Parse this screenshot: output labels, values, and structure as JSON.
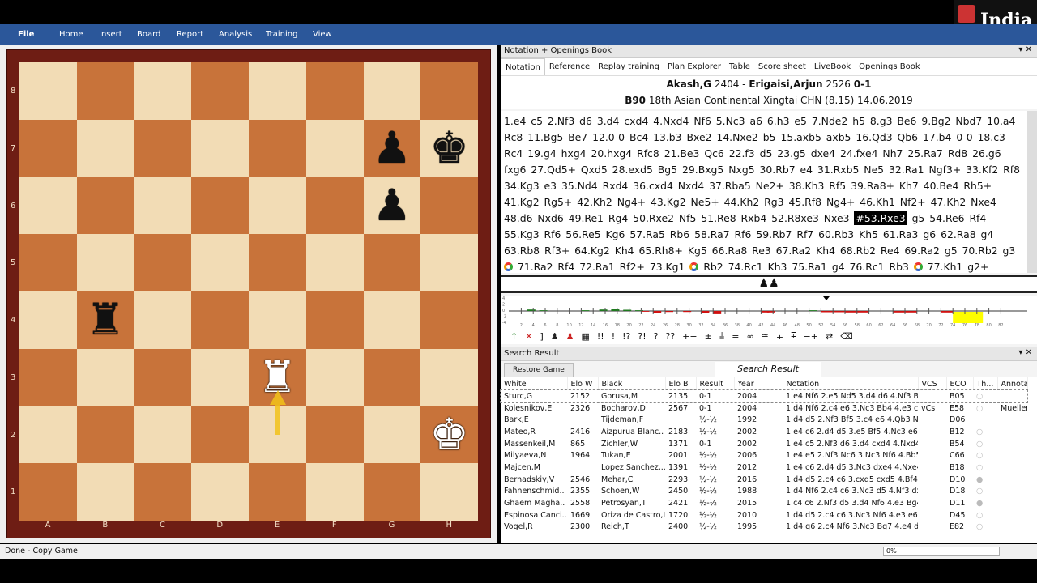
{
  "logo": "India",
  "menu": [
    "File",
    "Home",
    "Insert",
    "Board",
    "Report",
    "Analysis",
    "Training",
    "View"
  ],
  "board": {
    "ranks": [
      "8",
      "7",
      "6",
      "5",
      "4",
      "3",
      "2",
      "1"
    ],
    "files": [
      "A",
      "B",
      "C",
      "D",
      "E",
      "F",
      "G",
      "H"
    ],
    "pieces": {
      "g7": "black-pawn",
      "h7": "black-king",
      "g6": "black-pawn",
      "b4": "black-rook",
      "e3": "white-rook",
      "h2": "white-king"
    },
    "last_move_arrow": {
      "from": "e2",
      "to": "e3",
      "color": "#f2c21a"
    }
  },
  "panel_title": "Notation + Openings Book",
  "tabs": [
    "Notation",
    "Reference",
    "Replay training",
    "Plan Explorer",
    "Table",
    "Score sheet",
    "LiveBook",
    "Openings Book"
  ],
  "game": {
    "white": "Akash,G",
    "white_elo": "2404",
    "black": "Erigaisi,Arjun",
    "black_elo": "2526",
    "result": "0-1",
    "eco": "B90",
    "event": "18th Asian Continental Xingtai CHN (8.15) 14.06.2019"
  },
  "notation": [
    "1.e4 c5 2.Nf3 d6 3.d4 cxd4 4.Nxd4 Nf6 5.Nc3 a6 6.h3 e5 7.Nde2 h5 8.g3 Be6 9.Bg2 Nbd7 10.a4 Rc8 11.Bg5 Be7 12.0-0 Bc4 13.b3 Bxe2 14.Nxe2 b5 15.axb5 axb5 16.Qd3 Qb6 17.b4 0-0 18.c3 Rc4 19.g4 hxg4 20.hxg4 Rfc8 21.Be3 Qc6 22.f3 d5 23.g5 dxe4 24.fxe4 Nh7 25.Ra7 Rd8 26.g6 fxg6 27.Qd5+ Qxd5 28.exd5 Bg5 29.Bxg5 Nxg5 30.Rb7 e4 31.Rxb5 Ne5 32.Ra1 Ngf3+ 33.Kf2 Rf8 34.Kg3 e3 35.Nd4 Rxd4 36.cxd4 Nxd4 37.Rba5 Ne2+ 38.Kh3 Rf5 39.Ra8+ Kh7 40.Be4 Rh5+ 41.Kg2 Rg5+ 42.Kh2 Ng4+ 43.Kg2 Ne5+ 44.Kh2 Rg3 45.Rf8 Ng4+ 46.Kh1 Nf2+ 47.Kh2 Nxe4 48.d6 Nxd6 49.Re1 Rg4 50.Rxe2 Nf5 51.Re8 Rxb4 52.R8xe3 Nxe3",
    "#53.Rxe3",
    "g5 54.Re6 Rf4 55.Kg3 Rf6 56.Re5 Kg6 57.Ra5 Rb6 58.Ra7 Rf6 59.Rb7 Rf7 60.Rb3 Kh5 61.Ra3 g6 62.Ra8 g4 63.Rb8 Rf3+ 64.Kg2 Kh4 65.Rh8+ Kg5 66.Ra8 Re3 67.Ra2 Kh4 68.Rb2 Re4 69.Ra2 g5 70.Rb2 g3",
    "@",
    "71.Ra2 Rf4 72.Ra1 Rf2+ 73.Kg1",
    "@",
    "Rb2 74.Rc1 Kh3 75.Ra1 g4 76.Rc1 Rb3",
    "@",
    "77.Kh1 g2+ 78.Kg1 Rf3",
    "@"
  ],
  "graph": {
    "y_ticks": [
      "4",
      "2",
      "0",
      "-2",
      "-4"
    ],
    "x_ticks": [
      "2",
      "4",
      "6",
      "8",
      "10",
      "12",
      "14",
      "16",
      "18",
      "20",
      "22",
      "24",
      "26",
      "28",
      "30",
      "32",
      "34",
      "36",
      "38",
      "40",
      "42",
      "44",
      "46",
      "48",
      "50",
      "52",
      "54",
      "56",
      "58",
      "60",
      "62",
      "64",
      "66",
      "68",
      "70",
      "72",
      "74",
      "76",
      "78",
      "80",
      "82"
    ],
    "white_color": "#1e7a1e",
    "black_color": "#d01010",
    "highlight_color": "#ffff00"
  },
  "symbols": [
    "↑",
    "✕",
    "]",
    "♟",
    "♟",
    "▦",
    "!!",
    "!",
    "!?",
    "?!",
    "?",
    "??",
    "+−",
    "±",
    "⩲",
    "=",
    "∞",
    "≅",
    "∓",
    "⩱",
    "−+",
    "⇄",
    "⌫"
  ],
  "search": {
    "title": "Search Result",
    "restore": "Restore Game",
    "columns": [
      "White",
      "Elo W",
      "Black",
      "Elo B",
      "Result",
      "Year",
      "Notation",
      "VCS",
      "ECO",
      "Th...",
      "Annotato"
    ],
    "rows": [
      [
        "Sturc,G",
        "2152",
        "Gorusa,M",
        "2135",
        "0-1",
        "2004",
        "1.e4 Nf6 2.e5 Nd5 3.d4 d6 4.Nf3 Bg..",
        "",
        "B05",
        "○",
        ""
      ],
      [
        "Kolesnikov,E",
        "2326",
        "Bocharov,D",
        "2567",
        "0-1",
        "2004",
        "1.d4 Nf6 2.c4 e6 3.Nc3 Bb4 4.e3 c5..",
        "vCs",
        "E58",
        "○",
        "Mueller,K"
      ],
      [
        "Bark,E",
        "",
        "Tijdeman,F",
        "",
        "½-½",
        "1992",
        "1.d4 d5 2.Nf3 Bf5 3.c4 e6 4.Qb3 Nc..",
        "",
        "D06",
        "",
        ""
      ],
      [
        "Mateo,R",
        "2416",
        "Aizpurua Blanc..",
        "2183",
        "½-½",
        "2002",
        "1.e4 c6 2.d4 d5 3.e5 Bf5 4.Nc3 e6 5..",
        "",
        "B12",
        "○",
        ""
      ],
      [
        "Massenkeil,M",
        "865",
        "Zichler,W",
        "1371",
        "0-1",
        "2002",
        "1.e4 c5 2.Nf3 d6 3.d4 cxd4 4.Nxd4..",
        "",
        "B54",
        "○",
        ""
      ],
      [
        "Milyaeva,N",
        "1964",
        "Tukan,E",
        "2001",
        "½-½",
        "2006",
        "1.e4 e5 2.Nf3 Nc6 3.Nc3 Nf6 4.Bb5..",
        "",
        "C66",
        "○",
        ""
      ],
      [
        "Majcen,M",
        "",
        "Lopez Sanchez,..",
        "1391",
        "½-½",
        "2012",
        "1.e4 c6 2.d4 d5 3.Nc3 dxe4 4.Nxe4..",
        "",
        "B18",
        "○",
        ""
      ],
      [
        "Bernadskiy,V",
        "2546",
        "Mehar,C",
        "2293",
        "½-½",
        "2016",
        "1.d4 d5 2.c4 c6 3.cxd5 cxd5 4.Bf4 N..",
        "",
        "D10",
        "●",
        ""
      ],
      [
        "Fahnenschmid..",
        "2355",
        "Schoen,W",
        "2450",
        "½-½",
        "1988",
        "1.d4 Nf6 2.c4 c6 3.Nc3 d5 4.Nf3 dx..",
        "",
        "D18",
        "○",
        ""
      ],
      [
        "Ghaem Magha..",
        "2558",
        "Petrosyan,T",
        "2421",
        "½-½",
        "2015",
        "1.c4 c6 2.Nf3 d5 3.d4 Nf6 4.e3 Bg4..",
        "",
        "D11",
        "●",
        ""
      ],
      [
        "Espinosa Canci..",
        "1669",
        "Oriza de Castro,I",
        "1720",
        "½-½",
        "2010",
        "1.d4 d5 2.c4 c6 3.Nc3 Nf6 4.e3 e6 5..",
        "",
        "D45",
        "○",
        ""
      ],
      [
        "Vogel,R",
        "2300",
        "Reich,T",
        "2400",
        "½-½",
        "1995",
        "1.d4 g6 2.c4 Nf6 3.Nc3 Bg7 4.e4 d6..",
        "",
        "E82",
        "○",
        ""
      ]
    ]
  },
  "status": "Done - Copy Game",
  "progress": "0%"
}
